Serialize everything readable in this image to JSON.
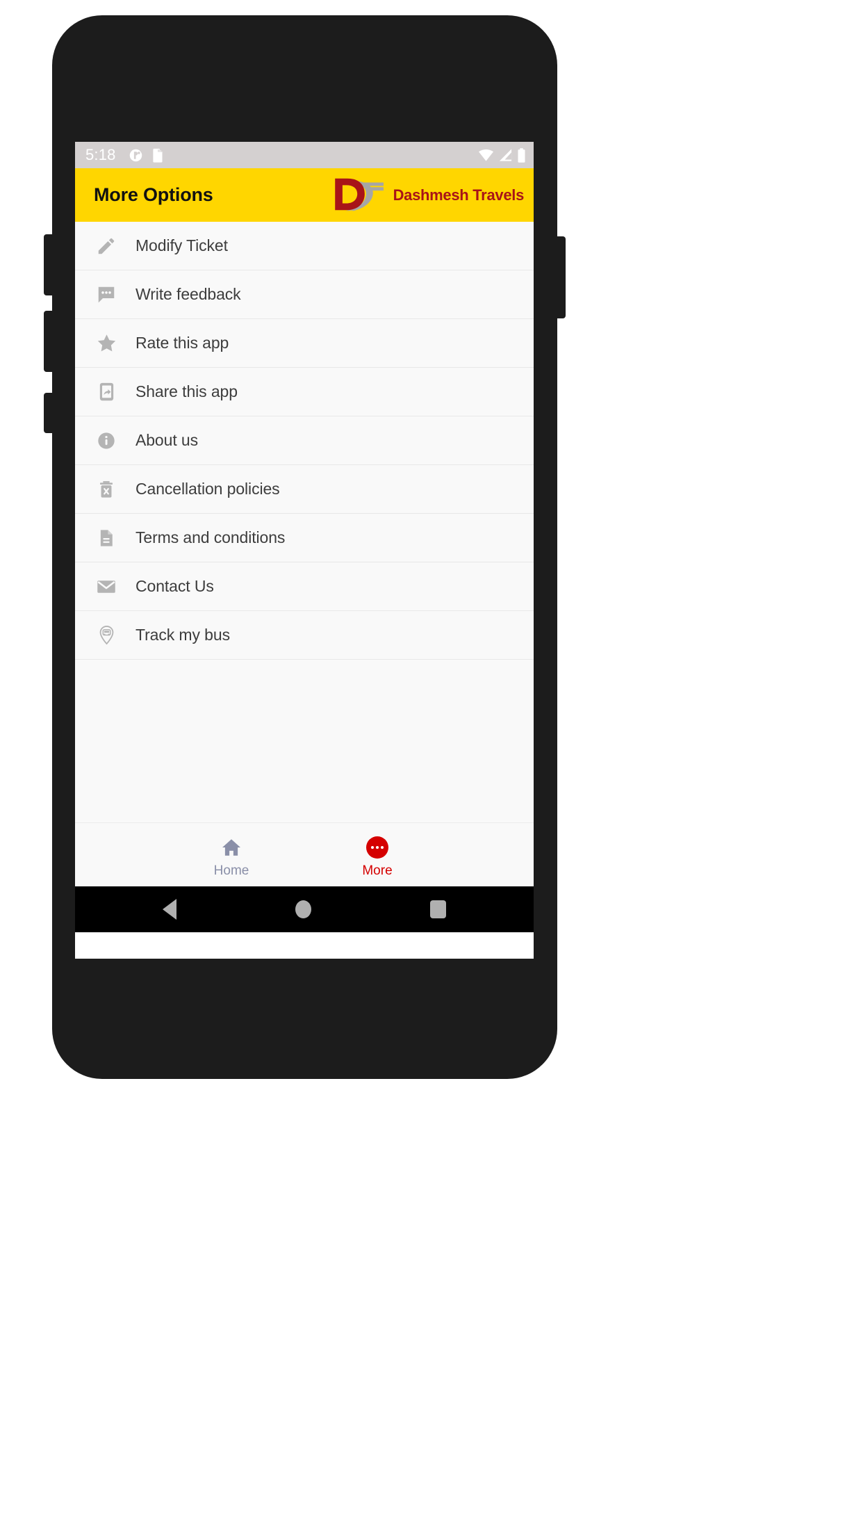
{
  "status_bar": {
    "clock": "5:18",
    "left_icons": [
      "alarm-or-app-icon",
      "sd-card-icon"
    ],
    "right_icons": [
      "wifi-icon",
      "cellular-signal-icon",
      "battery-icon"
    ]
  },
  "app_bar": {
    "title": "More Options",
    "brand_name": "Dashmesh Travels",
    "brand_letter": "D",
    "background_color": "#ffd600",
    "brand_color": "#a81418",
    "swoosh_color": "#a6a6a6"
  },
  "menu": {
    "items": [
      {
        "label": "Modify Ticket",
        "icon": "pencil-icon"
      },
      {
        "label": "Write feedback",
        "icon": "chat-bubble-icon"
      },
      {
        "label": "Rate this app",
        "icon": "star-icon"
      },
      {
        "label": "Share this app",
        "icon": "share-phone-icon"
      },
      {
        "label": "About us",
        "icon": "info-circle-icon"
      },
      {
        "label": "Cancellation policies",
        "icon": "trash-x-icon"
      },
      {
        "label": "Terms and conditions",
        "icon": "document-icon"
      },
      {
        "label": "Contact Us",
        "icon": "envelope-icon"
      },
      {
        "label": "Track my bus",
        "icon": "map-pin-bus-icon"
      }
    ]
  },
  "bottom_nav": {
    "tabs": [
      {
        "label": "Home",
        "icon": "home-icon",
        "active": false,
        "color": "#8a8fa8"
      },
      {
        "label": "More",
        "icon": "more-dots-icon",
        "active": true,
        "color": "#d50000"
      }
    ]
  },
  "android_nav": {
    "buttons": [
      "back-icon",
      "home-icon",
      "recents-icon"
    ]
  }
}
